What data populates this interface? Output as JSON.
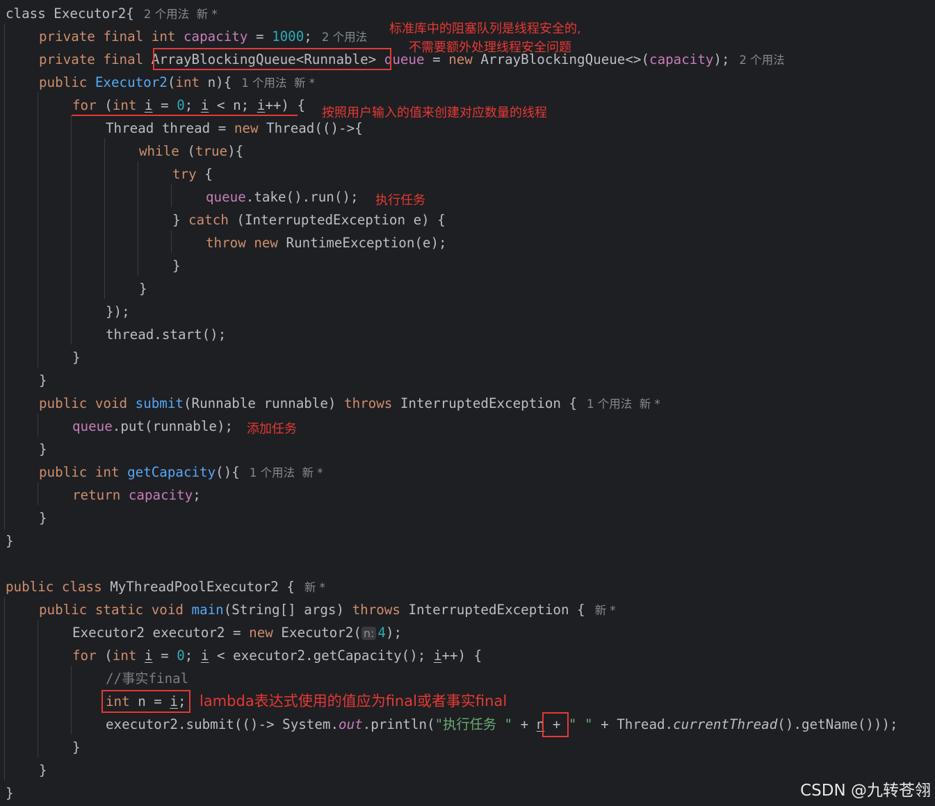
{
  "editor": {
    "code": {
      "l1": {
        "t0": "class Executor2{",
        "hint": "2 个用法  新 *"
      },
      "l2": {
        "t0": "private",
        "t1": " ",
        "t2": "final",
        "t3": " ",
        "t4": "int",
        "t5": " ",
        "t6": "capacity",
        "t7": " = ",
        "t8": "1000",
        "t9": ";",
        "hint": "2 个用法"
      },
      "l3": {
        "t0": "private",
        "t1": " ",
        "t2": "final",
        "t3": " ",
        "t4": "ArrayBlockingQueue<Runnable>",
        "t5": " ",
        "t6": "queue",
        "t7": " = ",
        "t8": "new",
        "t9": " ArrayBlockingQueue<>(",
        "t10": "capacity",
        "t11": ");",
        "hint": "2 个用法"
      },
      "l4": {
        "t0": "public",
        "t1": " ",
        "t2": "Executor2",
        "t3": "(",
        "t4": "int",
        "t5": " n){",
        "hint": "1 个用法  新 *"
      },
      "l5": {
        "t0": "for",
        "t1": " (",
        "t2": "int",
        "t3": " ",
        "t4": "i",
        "t5": " = ",
        "t6": "0",
        "t7": "; ",
        "t8": "i",
        "t9": " < n; ",
        "t10": "i",
        "t11": "++) {"
      },
      "l6": {
        "t0": "Thread thread = ",
        "t1": "new",
        "t2": " Thread(()->{"
      },
      "l7": {
        "t0": "while",
        "t1": " (",
        "t2": "true",
        "t3": "){"
      },
      "l8": {
        "t0": "try",
        "t1": " {"
      },
      "l9": {
        "t0": "queue",
        "t1": ".take().run();"
      },
      "l10": {
        "t0": "} ",
        "t1": "catch",
        "t2": " (InterruptedException e) {"
      },
      "l11": {
        "t0": "throw",
        "t1": " ",
        "t2": "new",
        "t3": " RuntimeException(e);"
      },
      "l12": {
        "t0": "}"
      },
      "l13": {
        "t0": "}"
      },
      "l14": {
        "t0": "});"
      },
      "l15": {
        "t0": "thread.start();"
      },
      "l16": {
        "t0": "}"
      },
      "l17": {
        "t0": "}"
      },
      "l18": {
        "t0": "public",
        "t1": " ",
        "t2": "void",
        "t3": " ",
        "t4": "submit",
        "t5": "(Runnable runnable) ",
        "t6": "throws",
        "t7": " InterruptedException {",
        "hint": "1 个用法  新 *"
      },
      "l19": {
        "t0": "queue",
        "t1": ".put(runnable);"
      },
      "l20": {
        "t0": "}"
      },
      "l21": {
        "t0": "public",
        "t1": " ",
        "t2": "int",
        "t3": " ",
        "t4": "getCapacity",
        "t5": "(){",
        "hint": "1 个用法  新 *"
      },
      "l22": {
        "t0": "return",
        "t1": " ",
        "t2": "capacity",
        "t3": ";"
      },
      "l23": {
        "t0": "}"
      },
      "l24": {
        "t0": "}"
      },
      "l26": {
        "t0": "public",
        "t1": " ",
        "t2": "class",
        "t3": " MyThreadPoolExecutor2 {",
        "hint": "新 *"
      },
      "l27": {
        "t0": "public",
        "t1": " ",
        "t2": "static",
        "t3": " ",
        "t4": "void",
        "t5": " ",
        "t6": "main",
        "t7": "(String[] args) ",
        "t8": "throws",
        "t9": " InterruptedException {",
        "hint": "新 *"
      },
      "l28": {
        "t0": "Executor2 executor2 = ",
        "t1": "new",
        "t2": " Executor2(",
        "ph": "n:",
        "t3": "4",
        "t4": ");"
      },
      "l29": {
        "t0": "for",
        "t1": " (",
        "t2": "int",
        "t3": " ",
        "t4": "i",
        "t5": " = ",
        "t6": "0",
        "t7": "; ",
        "t8": "i",
        "t9": " < executor2.getCapacity(); ",
        "t10": "i",
        "t11": "++) {"
      },
      "l30": {
        "t0": "//事实final"
      },
      "l31": {
        "t0": "int",
        "t1": " n = ",
        "t2": "i",
        "t3": ";"
      },
      "l32": {
        "t0": "executor2.submit(()-> System.",
        "t1": "out",
        "t2": ".println(",
        "t3": "\"执行任务 \"",
        "t4": " + ",
        "t5": "n",
        "t6": " + ",
        "t7": "\" \"",
        "t8": " + Thread.",
        "t9": "currentThread",
        "t10": "().getName()));"
      },
      "l33": {
        "t0": "}"
      },
      "l34": {
        "t0": "}"
      },
      "l35": {
        "t0": "}"
      }
    },
    "annotations": {
      "thread_safe_1": "标准库中的阻塞队列是线程安全的,",
      "thread_safe_2": "不需要额外处理线程安全问题",
      "create_threads": "按照用户输入的值来创建对应数量的线程",
      "exec_task": "执行任务",
      "add_task": "添加任务",
      "lambda_final": "lambda表达式使用的值应为final或者事实final"
    },
    "annotation_color": "#e53935"
  },
  "watermark": "CSDN @九转苍翎"
}
